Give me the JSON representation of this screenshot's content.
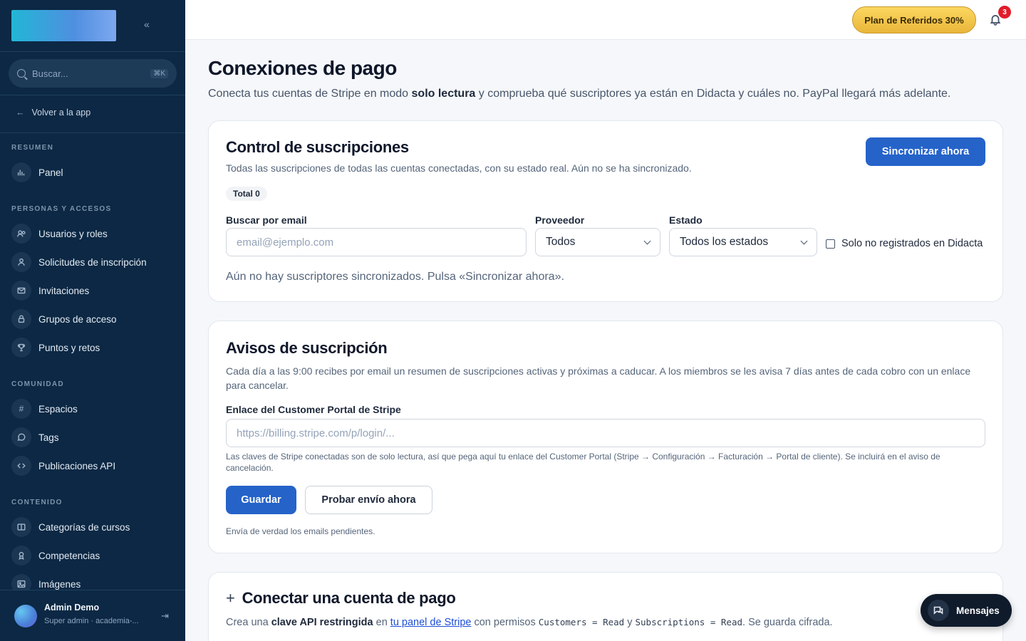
{
  "sidebar": {
    "search_placeholder": "Buscar...",
    "search_shortcut": "⌘K",
    "back_label": "Volver a la app",
    "sections": {
      "resumen": "RESUMEN",
      "personas": "PERSONAS Y ACCESOS",
      "comunidad": "COMUNIDAD",
      "contenido": "CONTENIDO"
    },
    "items": {
      "panel": "Panel",
      "usuarios": "Usuarios y roles",
      "solicitudes": "Solicitudes de inscripción",
      "invitaciones": "Invitaciones",
      "grupos": "Grupos de acceso",
      "puntos": "Puntos y retos",
      "espacios": "Espacios",
      "tags": "Tags",
      "publicaciones": "Publicaciones API",
      "categorias": "Categorías de cursos",
      "competencias": "Competencias",
      "imagenes": "Imágenes"
    },
    "user": {
      "name": "Admin Demo",
      "role": "Super admin · academia-..."
    }
  },
  "topbar": {
    "referral_label": "Plan de Referidos 30%",
    "notifications_count": "3"
  },
  "page": {
    "title": "Conexiones de pago",
    "subtitle_pre": "Conecta tus cuentas de Stripe en modo ",
    "subtitle_bold": "solo lectura",
    "subtitle_post": " y comprueba qué suscriptores ya están en Didacta y cuáles no. PayPal llegará más adelante."
  },
  "control": {
    "title": "Control de suscripciones",
    "description": "Todas las suscripciones de todas las cuentas conectadas, con su estado real. Aún no se ha sincronizado.",
    "sync_button": "Sincronizar ahora",
    "total_pill": "Total 0",
    "email_label": "Buscar por email",
    "email_placeholder": "email@ejemplo.com",
    "provider_label": "Proveedor",
    "provider_value": "Todos",
    "status_label": "Estado",
    "status_value": "Todos los estados",
    "only_unregistered": "Solo no registrados en Didacta",
    "empty_message": "Aún no hay suscriptores sincronizados. Pulsa «Sincronizar ahora»."
  },
  "avisos": {
    "title": "Avisos de suscripción",
    "description": "Cada día a las 9:00 recibes por email un resumen de suscripciones activas y próximas a caducar. A los miembros se les avisa 7 días antes de cada cobro con un enlace para cancelar.",
    "portal_label": "Enlace del Customer Portal de Stripe",
    "portal_placeholder": "https://billing.stripe.com/p/login/...",
    "portal_help": "Las claves de Stripe conectadas son de solo lectura, así que pega aquí tu enlace del Customer Portal (Stripe → Configuración → Facturación → Portal de cliente). Se incluirá en el aviso de cancelación.",
    "save_button": "Guardar",
    "test_button": "Probar envío ahora",
    "test_help": "Envía de verdad los emails pendientes."
  },
  "connect": {
    "plus": "+",
    "title": "Conectar una cuenta de pago",
    "desc_1": "Crea una ",
    "desc_bold": "clave API restringida",
    "desc_2": " en ",
    "desc_link": "tu panel de Stripe",
    "desc_3": " con permisos ",
    "desc_code1": "Customers = Read",
    "desc_4": " y ",
    "desc_code2": "Subscriptions = Read",
    "desc_5": ". Se guarda cifrada."
  },
  "chat": {
    "label": "Mensajes"
  }
}
